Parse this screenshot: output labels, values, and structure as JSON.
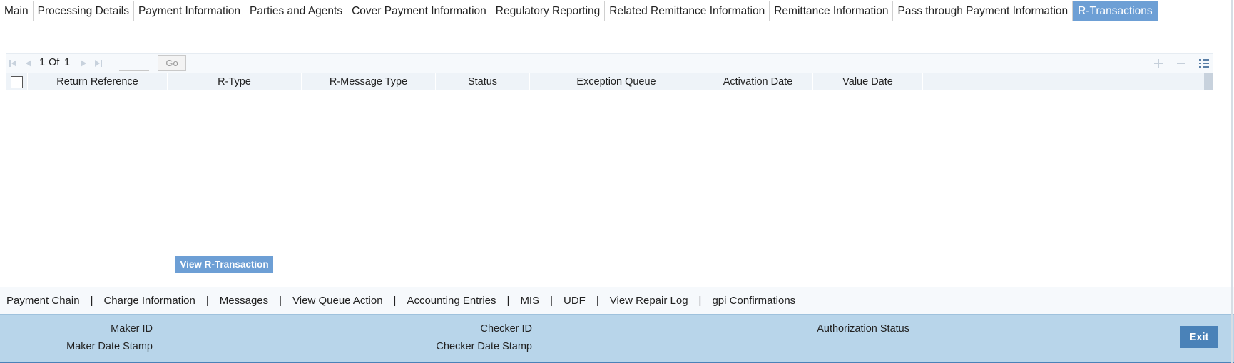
{
  "tabs": [
    {
      "label": "Main"
    },
    {
      "label": "Processing Details"
    },
    {
      "label": "Payment Information"
    },
    {
      "label": "Parties and Agents"
    },
    {
      "label": "Cover Payment Information"
    },
    {
      "label": "Regulatory Reporting"
    },
    {
      "label": "Related Remittance Information"
    },
    {
      "label": "Remittance Information"
    },
    {
      "label": "Pass through Payment Information"
    },
    {
      "label": "R-Transactions",
      "active": true
    }
  ],
  "grid": {
    "pagination": {
      "current": "1",
      "of_label": "Of",
      "total": "1",
      "go_label": "Go",
      "page_input_value": ""
    },
    "columns": [
      {
        "label": "Return Reference"
      },
      {
        "label": "R-Type"
      },
      {
        "label": "R-Message Type"
      },
      {
        "label": "Status"
      },
      {
        "label": "Exception Queue"
      },
      {
        "label": "Activation Date"
      },
      {
        "label": "Value Date"
      }
    ],
    "rows": [],
    "toolbar_icons": [
      "add-row-icon",
      "remove-row-icon",
      "single-record-view-icon"
    ]
  },
  "actions": {
    "view_r_transaction": "View R-Transaction"
  },
  "bottom_links": [
    "Payment Chain",
    "Charge Information",
    "Messages",
    "View Queue Action",
    "Accounting Entries",
    "MIS",
    "UDF",
    "View Repair Log",
    "gpi Confirmations"
  ],
  "link_separator": "|",
  "footer": {
    "maker_id_label": "Maker ID",
    "maker_date_label": "Maker Date Stamp",
    "checker_id_label": "Checker ID",
    "checker_date_label": "Checker Date Stamp",
    "auth_status_label": "Authorization Status",
    "exit_label": "Exit"
  },
  "colors": {
    "active_tab": "#6d9fd5",
    "footer_bg": "#b8d5ea",
    "exit_button": "#4a82b8"
  }
}
